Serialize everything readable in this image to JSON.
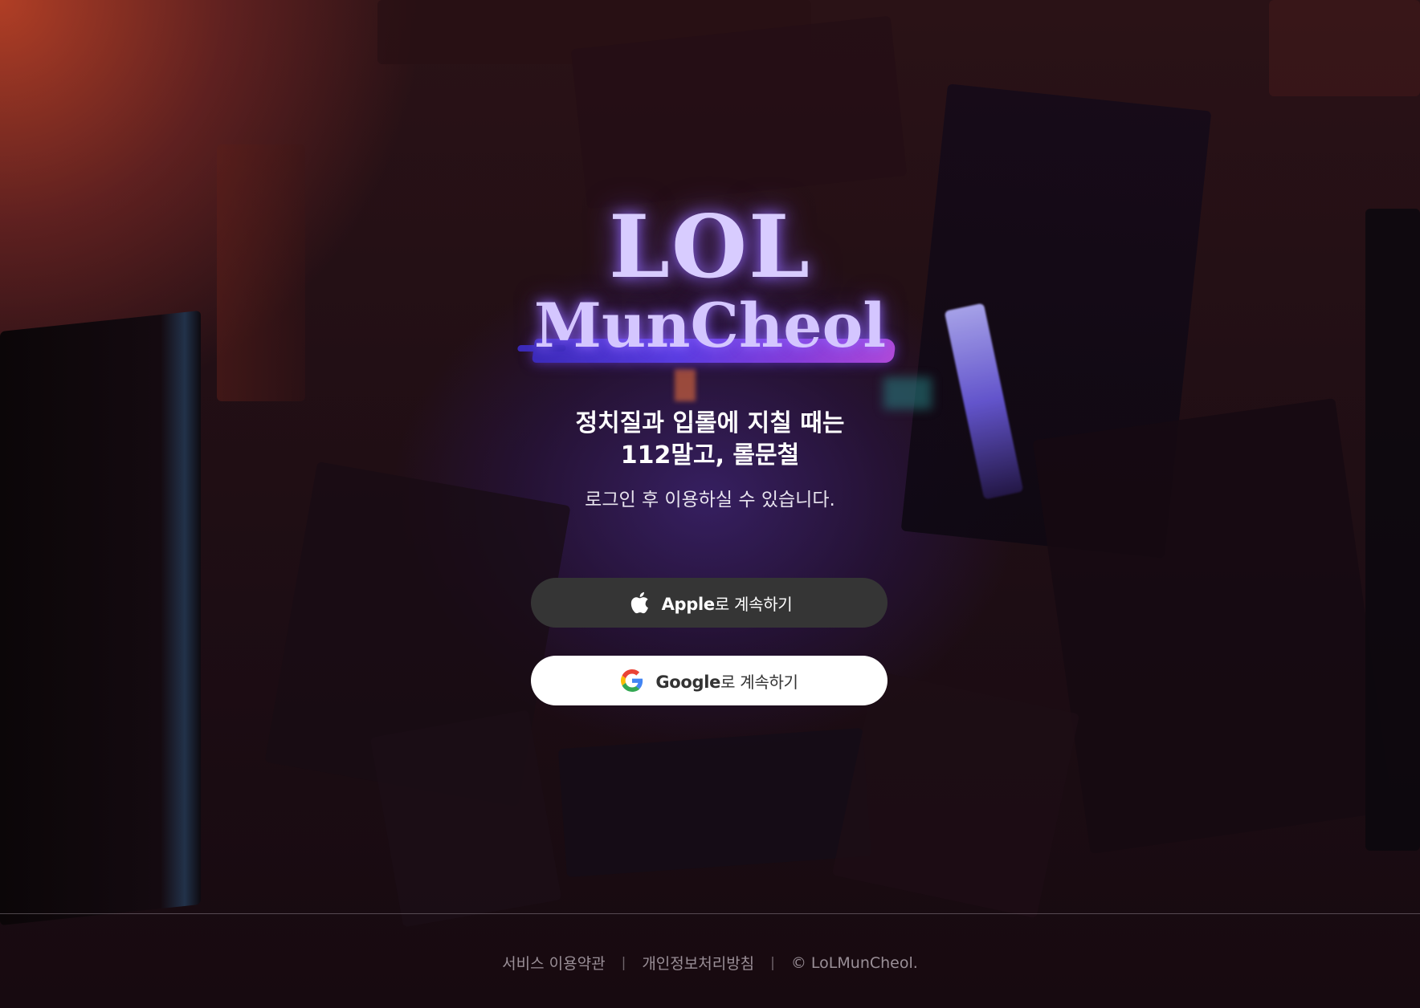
{
  "brand": {
    "logo_line1": "LOL",
    "logo_line2": "MunCheol"
  },
  "hero": {
    "tagline_line1": "정치질과 입롤에 지칠 때는",
    "tagline_line2": "112말고, 롤문철",
    "subtext": "로그인 후 이용하실 수 있습니다."
  },
  "login": {
    "apple": {
      "brand": "Apple",
      "suffix": "로 계속하기",
      "icon": "apple-icon",
      "bg": "#353535"
    },
    "google": {
      "brand": "Google",
      "suffix": "로 계속하기",
      "icon": "google-icon",
      "bg": "#ffffff"
    }
  },
  "footer": {
    "terms": "서비스 이용약관",
    "privacy": "개인정보처리방침",
    "separator": "|",
    "copyright": "© LoLMunCheol."
  }
}
